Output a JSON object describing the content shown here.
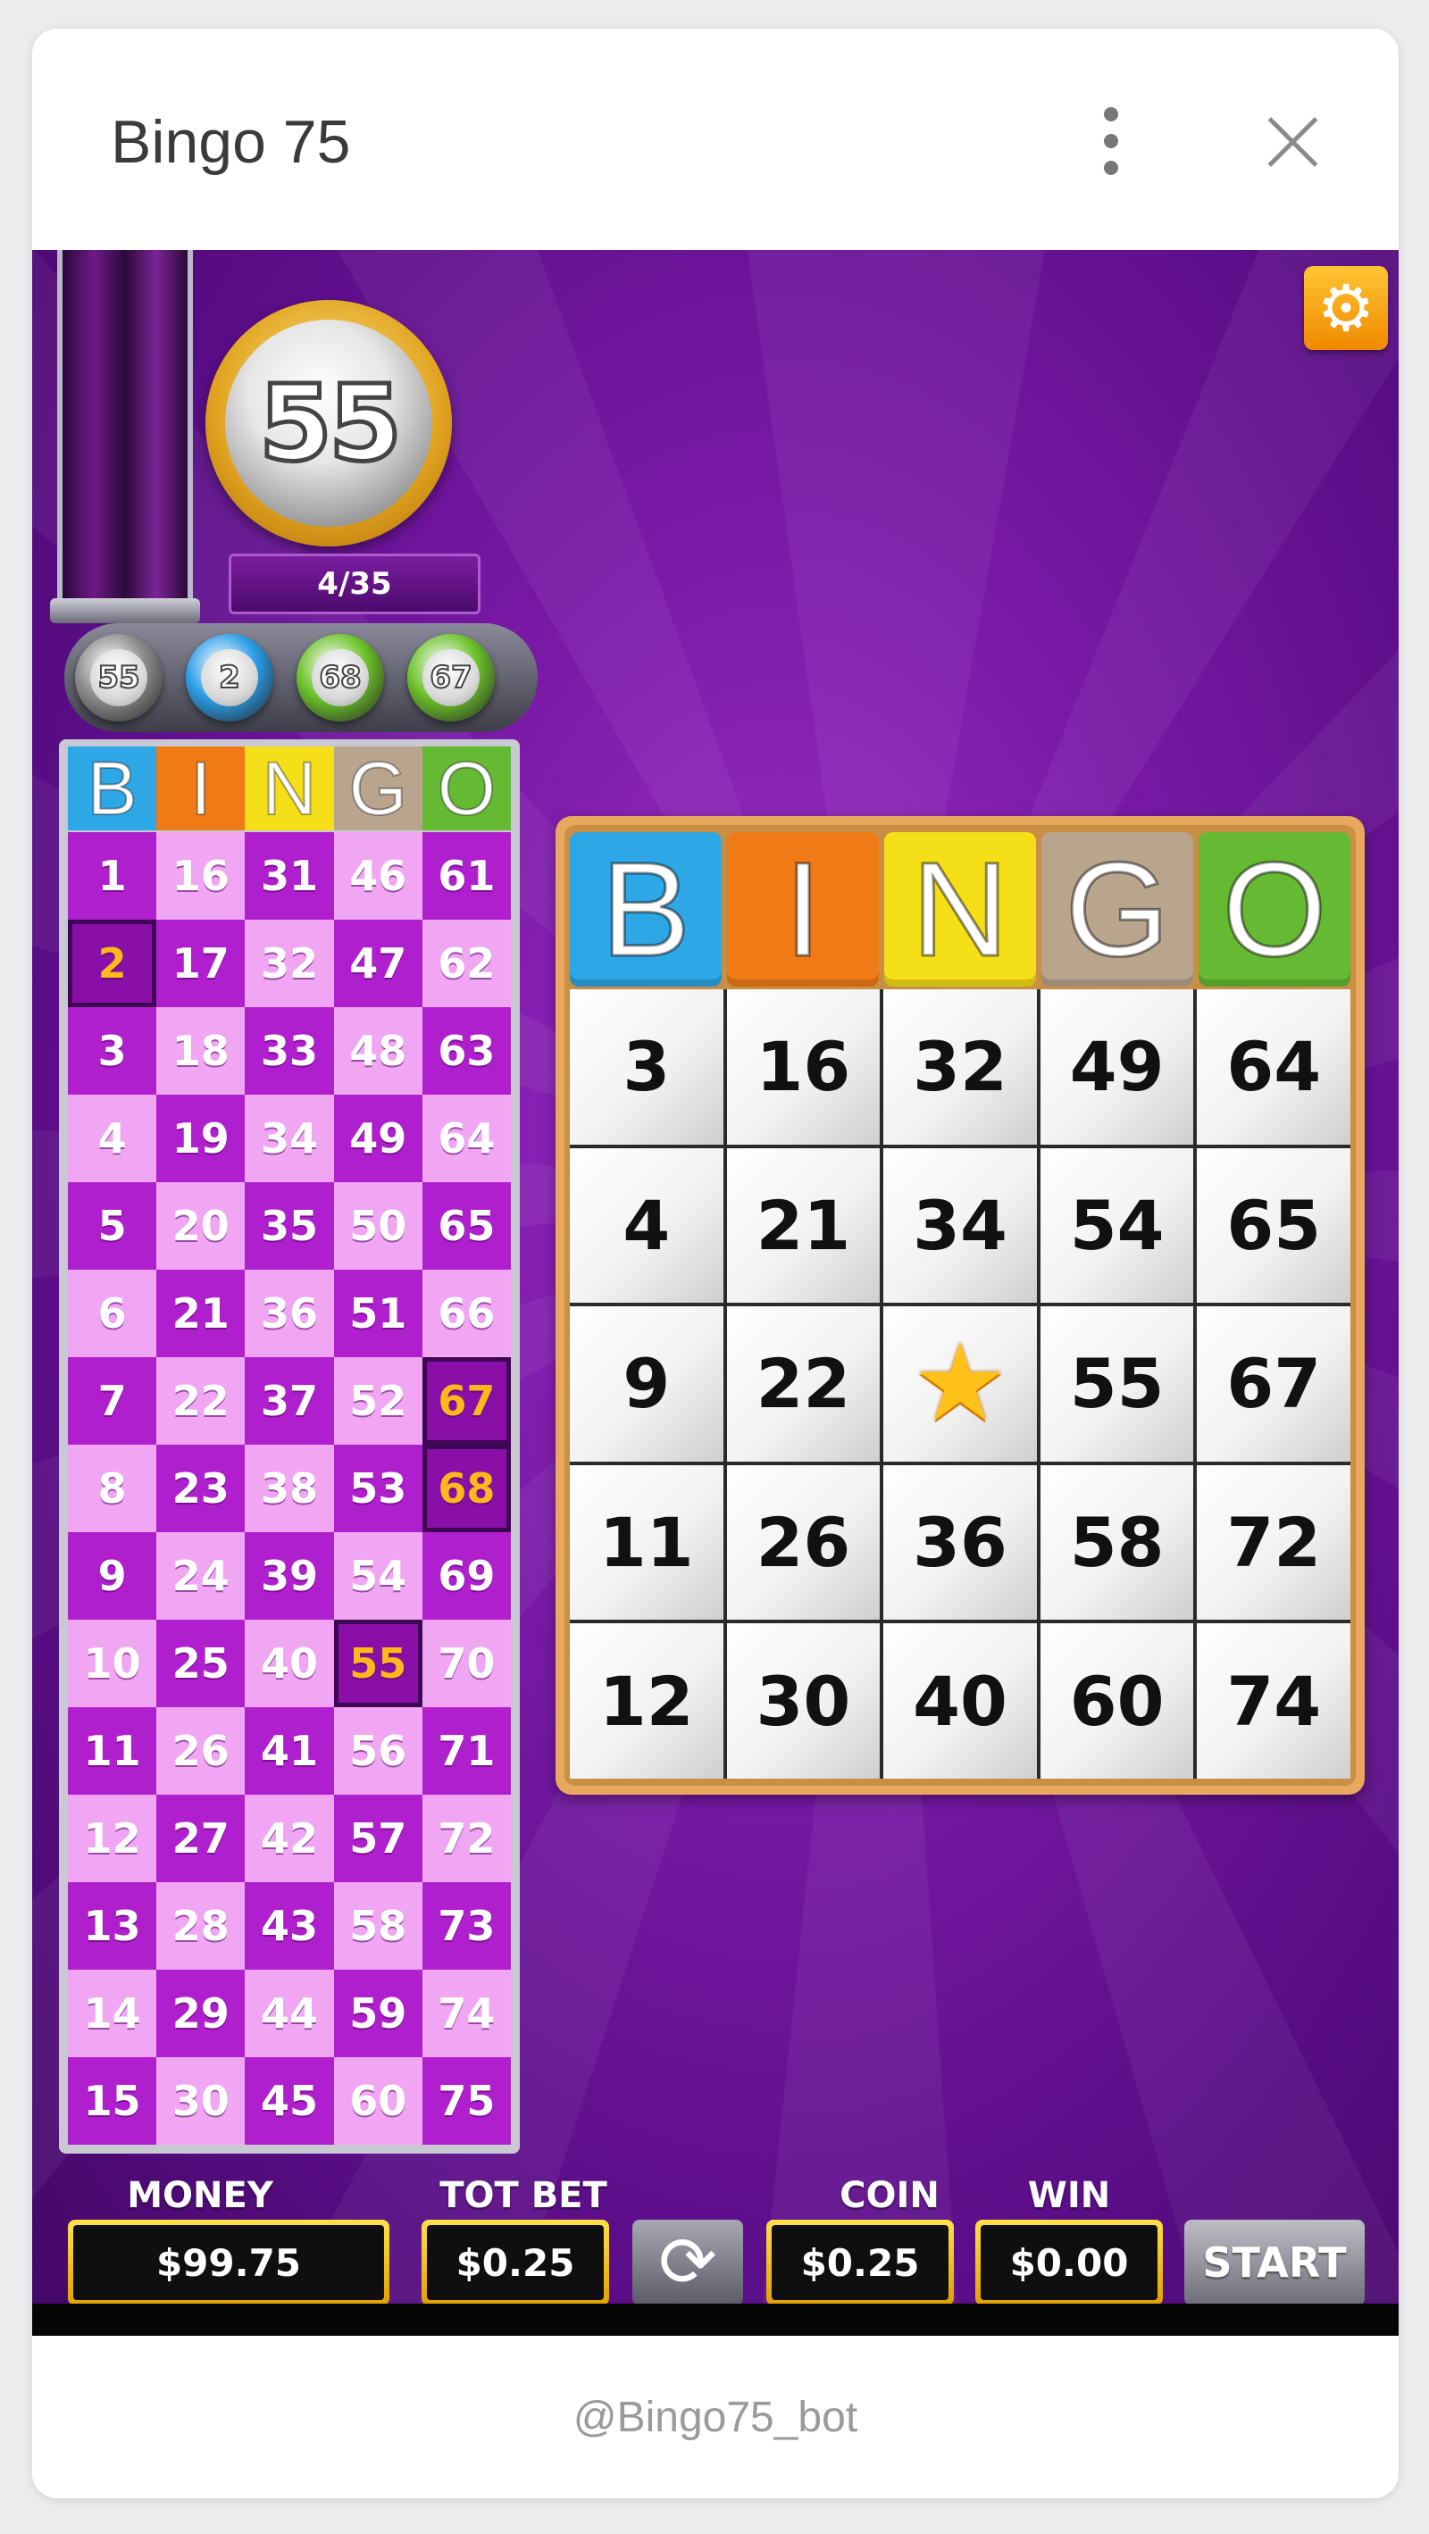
{
  "window": {
    "title": "Bingo 75",
    "footer": "@Bingo75_bot"
  },
  "icons": {
    "menu": "vertical-dots-icon",
    "close": "close-icon",
    "settings": "gear-icon",
    "refresh": "refresh-icon",
    "star": "star-icon"
  },
  "game": {
    "current_ball": "55",
    "ball_count": "4/35",
    "recent_balls": [
      {
        "number": "55",
        "color": "#8c8c8c"
      },
      {
        "number": "2",
        "color": "#2b9ee8"
      },
      {
        "number": "68",
        "color": "#6cc22a"
      },
      {
        "number": "67",
        "color": "#6cc22a"
      }
    ],
    "letters": [
      "B",
      "I",
      "N",
      "G",
      "O"
    ],
    "letter_colors": [
      "#2ea7e6",
      "#f07b16",
      "#f5df18",
      "#b9a48e",
      "#66b933"
    ],
    "called_numbers": [
      2,
      55,
      67,
      68
    ],
    "card": [
      [
        "3",
        "16",
        "32",
        "49",
        "64"
      ],
      [
        "4",
        "21",
        "34",
        "54",
        "65"
      ],
      [
        "9",
        "22",
        "★",
        "55",
        "67"
      ],
      [
        "11",
        "26",
        "36",
        "58",
        "72"
      ],
      [
        "12",
        "30",
        "40",
        "60",
        "74"
      ]
    ]
  },
  "hud": {
    "money_label": "MONEY",
    "money_value": "$99.75",
    "totbet_label": "TOT BET",
    "totbet_value": "$0.25",
    "coin_label": "COIN",
    "coin_value": "$0.25",
    "win_label": "WIN",
    "win_value": "$0.00",
    "start_label": "START"
  }
}
